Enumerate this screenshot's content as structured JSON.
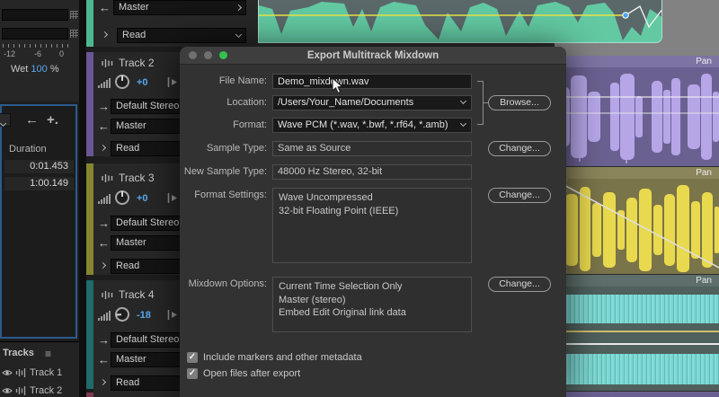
{
  "window": {
    "title": "Export Multitrack Mixdown"
  },
  "dialog": {
    "file_name_label": "File Name:",
    "file_name_value": "Demo_mixdown.wav",
    "location_label": "Location:",
    "location_value": "/Users/Your_Name/Documents",
    "format_label": "Format:",
    "format_value": "Wave PCM (*.wav, *.bwf, *.rf64, *.amb)",
    "sample_type_label": "Sample Type:",
    "sample_type_value": "Same as Source",
    "new_sample_type_label": "New Sample Type:",
    "new_sample_type_value": "48000 Hz Stereo, 32-bit",
    "format_settings_label": "Format Settings:",
    "format_settings_lines": [
      "Wave Uncompressed",
      "32-bit Floating Point (IEEE)"
    ],
    "mixdown_options_label": "Mixdown Options:",
    "mixdown_options_lines": [
      "Current Time Selection Only",
      "Master (stereo)",
      "Embed Edit Original link data"
    ],
    "browse_button": "Browse...",
    "change_button": "Change...",
    "checkbox_markers": "Include markers and other metadata",
    "checkbox_open": "Open files after export"
  },
  "fx_panel": {
    "ticks": [
      "-12",
      "-6",
      "0"
    ],
    "wet_label": "Wet",
    "wet_value": "100",
    "wet_unit": "%"
  },
  "selection_panel": {
    "duration_header": "Duration",
    "durations": [
      "0:01.453",
      "1:00.149"
    ]
  },
  "tracks_panel": {
    "title": "Tracks",
    "items": [
      "Track 1",
      "Track 2"
    ]
  },
  "sidebar": {
    "track1_output": "Master",
    "track1_automation": "Read",
    "tracks": [
      {
        "name": "Track 2",
        "gain": "+0",
        "input": "Default Stereo",
        "output": "Master",
        "automation": "Read"
      },
      {
        "name": "Track 3",
        "gain": "+0",
        "input": "Default Stereo",
        "output": "Master",
        "automation": "Read"
      },
      {
        "name": "Track 4",
        "gain": "-18",
        "input": "Default Stereo",
        "output": "Master",
        "automation": "Read"
      }
    ]
  },
  "clips": {
    "pan_label": "Pan"
  },
  "icons": {
    "left_arrow": "←",
    "right_arrow": "→",
    "plus": "+.",
    "menu": "≡",
    "check": "✓"
  },
  "colors": {
    "accent_blue": "#57a9ef",
    "track1_strip": "#4db890",
    "track2_strip": "#6a5694",
    "track3_strip": "#85852f",
    "track4_strip": "#1f6a6a",
    "clip_mint_bg": "#62c9a2",
    "clip_purple_bg": "#6b6191",
    "clip_purple_wave": "#b6a6e8",
    "clip_olive_bg": "#7a744a",
    "clip_yellow_wave": "#e9d94e",
    "clip_teal_bg": "#4f605d",
    "clip_teal_wave": "#74d2cc",
    "traffic_green": "#35c24f"
  }
}
